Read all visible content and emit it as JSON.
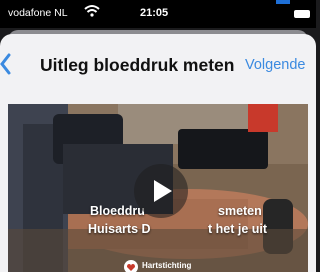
{
  "status_bar": {
    "carrier": "vodafone NL",
    "time": "21:05"
  },
  "nav": {
    "title": "Uitleg bloeddruk meten",
    "next_label": "Volgende"
  },
  "video": {
    "title_line1": "Bloeddru",
    "title_line1b": "smeten",
    "title_line2": "Huisarts D",
    "title_line2b": "t het je uit",
    "logo_text": "Hartstichting"
  },
  "colors": {
    "accent": "#3b8ae0",
    "sheet_bg": "#f2f2f4"
  }
}
